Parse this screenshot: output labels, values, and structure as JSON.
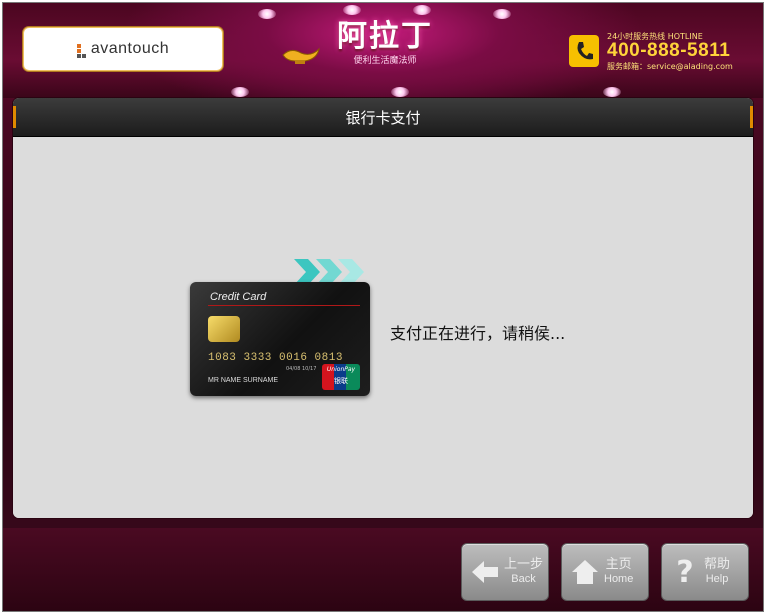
{
  "header": {
    "logo_text": "avantouch",
    "brand_title": "阿拉丁",
    "brand_subtitle": "便利生活魔法师",
    "hotline_label": "24小时服务热线 HOTLINE",
    "hotline_number": "400-888-5811",
    "service_email": "服务邮箱：service@alading.com"
  },
  "panel": {
    "title": "银行卡支付",
    "status_text": "支付正在进行，请稍侯..."
  },
  "card": {
    "title": "Credit Card",
    "number": "1083 3333 0016 0813",
    "valid_text": "04/08 10/17",
    "holder": "MR  NAME  SURNAME",
    "network_en": "UnionPay",
    "network_cn": "银联"
  },
  "footer": {
    "back_cn": "上一步",
    "back_en": "Back",
    "home_cn": "主页",
    "home_en": "Home",
    "help_cn": "帮助",
    "help_en": "Help"
  },
  "colors": {
    "accent_orange": "#e08a00",
    "hotline_yellow": "#ffd43a",
    "background_maroon": "#4a0822",
    "panel_gray": "#dcdcdc"
  },
  "icons": [
    "phone-icon",
    "lamp-icon",
    "chip-icon",
    "arrows-icon",
    "unionpay-logo",
    "back-arrow-icon",
    "home-icon",
    "help-icon"
  ]
}
